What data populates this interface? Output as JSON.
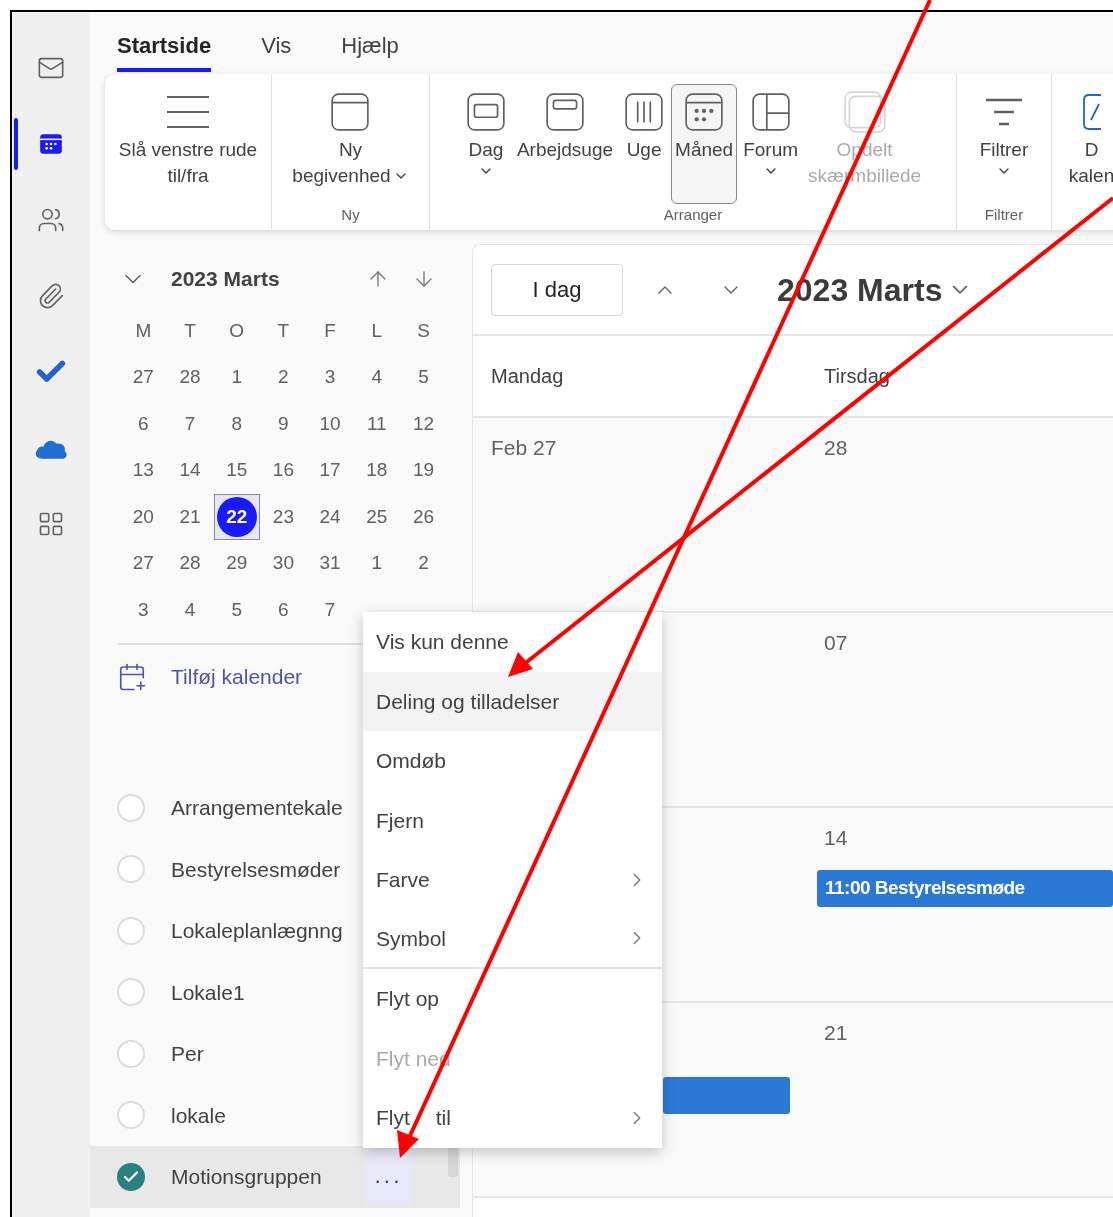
{
  "rail": [
    {
      "selected": false
    },
    {
      "selected": true
    },
    {
      "selected": false
    },
    {
      "selected": false
    },
    {
      "selected": false
    },
    {
      "selected": false
    },
    {
      "selected": false
    }
  ],
  "tabs": [
    {
      "label": "Startside",
      "selected": true
    },
    {
      "label": "Vis",
      "selected": false
    },
    {
      "label": "Hjælp",
      "selected": false
    }
  ],
  "ribbon": [
    {
      "items": [
        {
          "lines": [
            "Slå venstre rude",
            "til/fra"
          ],
          "dropdown": false,
          "selected": false,
          "disabled": false
        }
      ]
    },
    {
      "label": "Ny",
      "items": [
        {
          "lines": [
            "Ny",
            "begivenhed"
          ],
          "dropdown": true,
          "selected": false,
          "disabled": false
        }
      ]
    },
    {
      "label": "Arranger",
      "items": [
        {
          "lines": [
            "Dag"
          ],
          "dropdown": true,
          "selected": false,
          "disabled": false
        },
        {
          "lines": [
            "Arbejdsuge"
          ],
          "dropdown": false,
          "selected": false,
          "disabled": false
        },
        {
          "lines": [
            "Uge"
          ],
          "dropdown": false,
          "selected": false,
          "disabled": false
        },
        {
          "lines": [
            "Måned"
          ],
          "dropdown": false,
          "selected": true,
          "disabled": false
        },
        {
          "lines": [
            "Forum"
          ],
          "dropdown": true,
          "selected": false,
          "disabled": false
        },
        {
          "lines": [
            "Opdelt",
            "skærmbillede"
          ],
          "dropdown": false,
          "selected": false,
          "disabled": true
        }
      ]
    },
    {
      "label": "Filtrer",
      "items": [
        {
          "lines": [
            "Filtrer"
          ],
          "dropdown": true,
          "selected": false,
          "disabled": false
        }
      ]
    },
    {
      "items": [
        {
          "lines": [
            "D",
            "kalen"
          ],
          "dropdown": false,
          "selected": false,
          "disabled": false
        }
      ]
    }
  ],
  "mini_calendar": {
    "title": "2023 Marts",
    "weekdays": [
      "M",
      "T",
      "O",
      "T",
      "F",
      "L",
      "S"
    ],
    "weeks": [
      [
        {
          "day": "27",
          "selected": false
        },
        {
          "day": "28",
          "selected": false
        },
        {
          "day": "1",
          "selected": false
        },
        {
          "day": "2",
          "selected": false
        },
        {
          "day": "3",
          "selected": false
        },
        {
          "day": "4",
          "selected": false
        },
        {
          "day": "5",
          "selected": false
        }
      ],
      [
        {
          "day": "6",
          "selected": false
        },
        {
          "day": "7",
          "selected": false
        },
        {
          "day": "8",
          "selected": false
        },
        {
          "day": "9",
          "selected": false
        },
        {
          "day": "10",
          "selected": false
        },
        {
          "day": "11",
          "selected": false
        },
        {
          "day": "12",
          "selected": false
        }
      ],
      [
        {
          "day": "13",
          "selected": false
        },
        {
          "day": "14",
          "selected": false
        },
        {
          "day": "15",
          "selected": false
        },
        {
          "day": "16",
          "selected": false
        },
        {
          "day": "17",
          "selected": false
        },
        {
          "day": "18",
          "selected": false
        },
        {
          "day": "19",
          "selected": false
        }
      ],
      [
        {
          "day": "20",
          "selected": false
        },
        {
          "day": "21",
          "selected": false
        },
        {
          "day": "22",
          "selected": true
        },
        {
          "day": "23",
          "selected": false
        },
        {
          "day": "24",
          "selected": false
        },
        {
          "day": "25",
          "selected": false
        },
        {
          "day": "26",
          "selected": false
        }
      ],
      [
        {
          "day": "27",
          "selected": false
        },
        {
          "day": "28",
          "selected": false
        },
        {
          "day": "29",
          "selected": false
        },
        {
          "day": "30",
          "selected": false
        },
        {
          "day": "31",
          "selected": false
        },
        {
          "day": "1",
          "selected": false
        },
        {
          "day": "2",
          "selected": false
        }
      ],
      [
        {
          "day": "3",
          "selected": false
        },
        {
          "day": "4",
          "selected": false
        },
        {
          "day": "5",
          "selected": false
        },
        {
          "day": "6",
          "selected": false
        },
        {
          "day": "7",
          "selected": false
        }
      ]
    ]
  },
  "add_calendar": "Tilføj kalender",
  "calendars": [
    {
      "name": "Arrangementekale",
      "checked": false,
      "selected": false
    },
    {
      "name": "Bestyrelsesmøder",
      "checked": false,
      "selected": false
    },
    {
      "name": "Lokaleplanlægnng",
      "checked": false,
      "selected": false
    },
    {
      "name": "Lokale1",
      "checked": false,
      "selected": false
    },
    {
      "name": "Per",
      "checked": false,
      "selected": false
    },
    {
      "name": "lokale",
      "checked": false,
      "selected": false
    },
    {
      "name": "Motionsgruppen",
      "checked": true,
      "selected": true,
      "more": "···"
    }
  ],
  "context_menu": [
    {
      "label": "Vis kun denne",
      "highlighted": false,
      "disabled": false,
      "submenu": false,
      "divider_after": false
    },
    {
      "label": "Deling og tilladelser",
      "highlighted": true,
      "disabled": false,
      "submenu": false,
      "divider_after": false
    },
    {
      "label": "Omdøb",
      "highlighted": false,
      "disabled": false,
      "submenu": false,
      "divider_after": false
    },
    {
      "label": "Fjern",
      "highlighted": false,
      "disabled": false,
      "submenu": false,
      "divider_after": false
    },
    {
      "label": "Farve",
      "highlighted": false,
      "disabled": false,
      "submenu": true,
      "divider_after": false
    },
    {
      "label": "Symbol",
      "highlighted": false,
      "disabled": false,
      "submenu": true,
      "divider_after": true
    },
    {
      "label": "Flyt op",
      "highlighted": false,
      "disabled": false,
      "submenu": false,
      "divider_after": false
    },
    {
      "label": "Flyt ned",
      "highlighted": false,
      "disabled": true,
      "submenu": false,
      "divider_after": false
    },
    {
      "label": "Flyt til",
      "highlighted": false,
      "disabled": false,
      "submenu": true,
      "divider_after": false
    }
  ],
  "calendar": {
    "today_button": "I dag",
    "title": "2023 Marts",
    "columns": [
      "Mandag",
      "Tirsdag"
    ],
    "weeks": [
      {
        "monday": {
          "date": "Feb 27"
        },
        "tuesday": {
          "date": "28"
        }
      },
      {
        "tuesday": {
          "date": "07"
        }
      },
      {
        "tuesday": {
          "date": "14",
          "events": [
            {
              "title": "11:00 Bestyrelsesmøde",
              "color": "#2b79d6"
            }
          ]
        }
      },
      {
        "monday": {
          "events": [
            {
              "color": "#2b79d6"
            }
          ]
        },
        "tuesday": {
          "date": "21"
        }
      }
    ]
  }
}
